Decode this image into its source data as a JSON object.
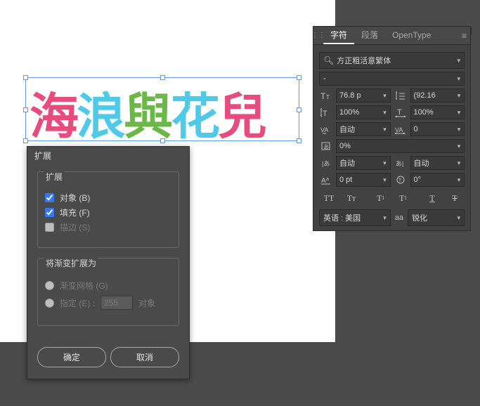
{
  "canvas_text": {
    "ch1": "海",
    "ch2": "浪",
    "ch3": "與",
    "ch4": "花",
    "ch5": "兒"
  },
  "expand_dialog": {
    "title": "扩展",
    "section1": "扩展",
    "obj": "对象 (B)",
    "fill": "填充 (F)",
    "stroke": "描边 (S)",
    "section2": "将渐变扩展为",
    "grad_mesh": "渐变网格 (G)",
    "specify": "指定 (E) :",
    "specify_val": "255",
    "specify_suffix": "对象",
    "ok": "确定",
    "cancel": "取消"
  },
  "char_panel": {
    "tabs": {
      "char": "字符",
      "para": "段落",
      "ot": "OpenType"
    },
    "font": "方正粗活意繁体",
    "style": "-",
    "size": "76.8 p",
    "leading": "(92.16",
    "vscale": "100%",
    "hscale": "100%",
    "kern": "自动",
    "track": "0",
    "baseline": "0%",
    "tsume_l": "自动",
    "tsume_r": "自动",
    "baseline_shift": "0 pt",
    "rotation": "0°",
    "language": "英语 : 美国",
    "antialiasing": "锐化",
    "antialiasing_prefix": "aa"
  }
}
